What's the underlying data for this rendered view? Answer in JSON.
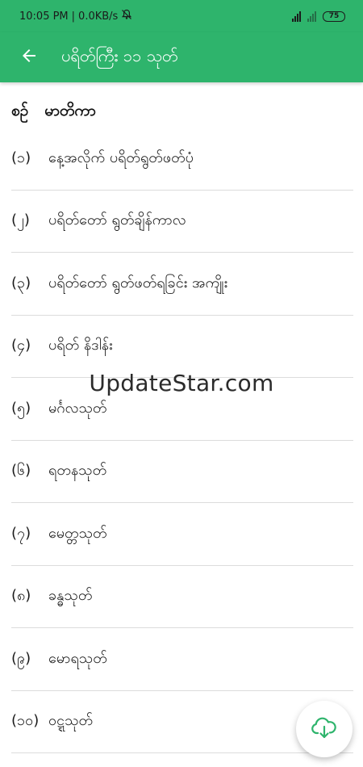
{
  "status_bar": {
    "time": "10:05 PM",
    "speed": "0.0KB/s",
    "battery": "75",
    "icons": [
      "mute-icon",
      "signal-icon",
      "battery-icon"
    ]
  },
  "app_bar": {
    "title": "ပရိတ်ကြီး ၁၁ သုတ်",
    "back_icon": "arrow-left-icon"
  },
  "table_header": {
    "page_col": "စဉ်",
    "title_col": "မာတိကာ"
  },
  "items": [
    {
      "num": "(၁)",
      "label": "နေ့အလိုက် ပရိတ်ရွတ်ဖတ်ပုံ"
    },
    {
      "num": "(၂)",
      "label": "ပရိတ်တော် ရွတ်ချိန်ကာလ"
    },
    {
      "num": "(၃)",
      "label": "ပရိတ်တော် ရွတ်ဖတ်ရခြင်း အကျိုး"
    },
    {
      "num": "(၄)",
      "label": "ပရိတ် နိဒါန်း"
    },
    {
      "num": "(၅)",
      "label": "မင်္ဂလသုတ်"
    },
    {
      "num": "(၆)",
      "label": "ရတနသုတ်"
    },
    {
      "num": "(၇)",
      "label": "မေတ္တသုတ်"
    },
    {
      "num": "(၈)",
      "label": "ခန္ဓသုတ်"
    },
    {
      "num": "(၉)",
      "label": "မောရသုတ်"
    },
    {
      "num": "(၁၀)",
      "label": "ဝဋ္ဋသုတ်"
    }
  ],
  "watermark": "UpdateStar.com",
  "fab": {
    "icon": "cloud-download-icon"
  },
  "colors": {
    "primary": "#2eb46c",
    "fab_icon": "#2eb46c",
    "divider": "#dcdcdc"
  }
}
